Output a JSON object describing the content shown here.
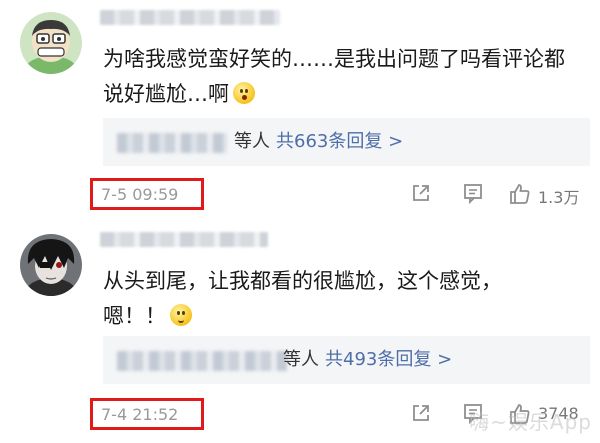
{
  "comments": [
    {
      "text": "为啥我感觉蛮好笑的……是我出问题了吗看评论都\n说好尴尬…啊",
      "emoji": "astonished-face",
      "reply_summary": {
        "who": "等人",
        "count_text": "共663条回复 >"
      },
      "time": "7-5 09:59",
      "likes": "1.3万"
    },
    {
      "text": "从头到尾，让我都看的很尴尬，这个感觉，\n嗯！！",
      "emoji": "smiling-face",
      "reply_summary": {
        "who": "等人",
        "count_text": "共493条回复 >"
      },
      "time": "7-4 21:52",
      "likes": "3748"
    }
  ],
  "watermark": "嗨~娱乐App",
  "colors": {
    "highlight": "#e01919",
    "link": "#4e6ea8",
    "muted": "#999999"
  }
}
